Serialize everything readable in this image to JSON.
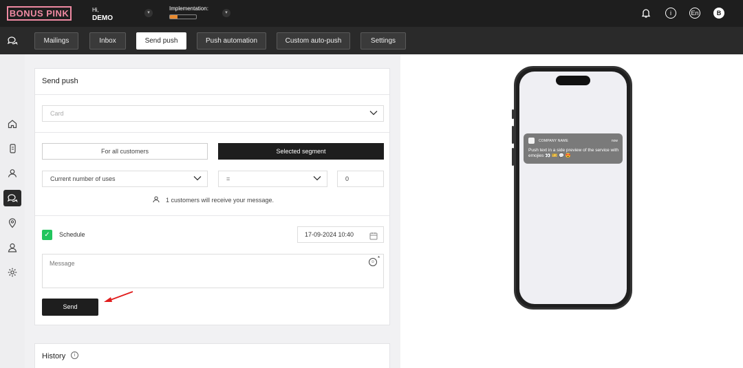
{
  "brand": {
    "logo_text": "BONUS PINK",
    "accent": "#f08aa3"
  },
  "header": {
    "greeting": "Hi,",
    "user_name": "DEMO",
    "implementation_label": "Implementation:",
    "implementation_progress": 0.3,
    "language": "En",
    "profile_initial": "B",
    "icons": [
      "bell-icon",
      "info-icon",
      "language-icon",
      "profile-icon"
    ]
  },
  "nav": {
    "tabs": [
      {
        "label": "Mailings",
        "active": false
      },
      {
        "label": "Inbox",
        "active": false
      },
      {
        "label": "Send push",
        "active": true
      },
      {
        "label": "Push automation",
        "active": false
      },
      {
        "label": "Custom auto-push",
        "active": false
      },
      {
        "label": "Settings",
        "active": false
      }
    ]
  },
  "sidebar": {
    "items": [
      "chat-icon",
      "home-icon",
      "card-icon",
      "customers-icon",
      "messages-icon",
      "location-icon",
      "user-icon",
      "settings-icon"
    ],
    "active": "messages-icon"
  },
  "form": {
    "title": "Send push",
    "card_placeholder": "Card",
    "audience": {
      "all": "For all customers",
      "segment": "Selected segment",
      "selected": "segment"
    },
    "filter": {
      "field": "Current number of uses",
      "operator": "=",
      "value": "0"
    },
    "recipients_text": "1 customers will receive your message.",
    "schedule_label": "Schedule",
    "schedule_checked": true,
    "schedule_datetime": "17-09-2024 10:40",
    "message_placeholder": "Message",
    "required_mark": "*",
    "send_label": "Send"
  },
  "history": {
    "title": "History"
  },
  "preview": {
    "app_name": "COMPANY NAME",
    "time": "now",
    "text": "Push text in a side preview of the service with emojies 👀 🎫 💬 😍"
  },
  "colors": {
    "dark": "#1e1e1e",
    "nav": "#2a2a2a",
    "check": "#22c55e",
    "progress": "#e98a2e",
    "arrow": "#e11d1d"
  }
}
